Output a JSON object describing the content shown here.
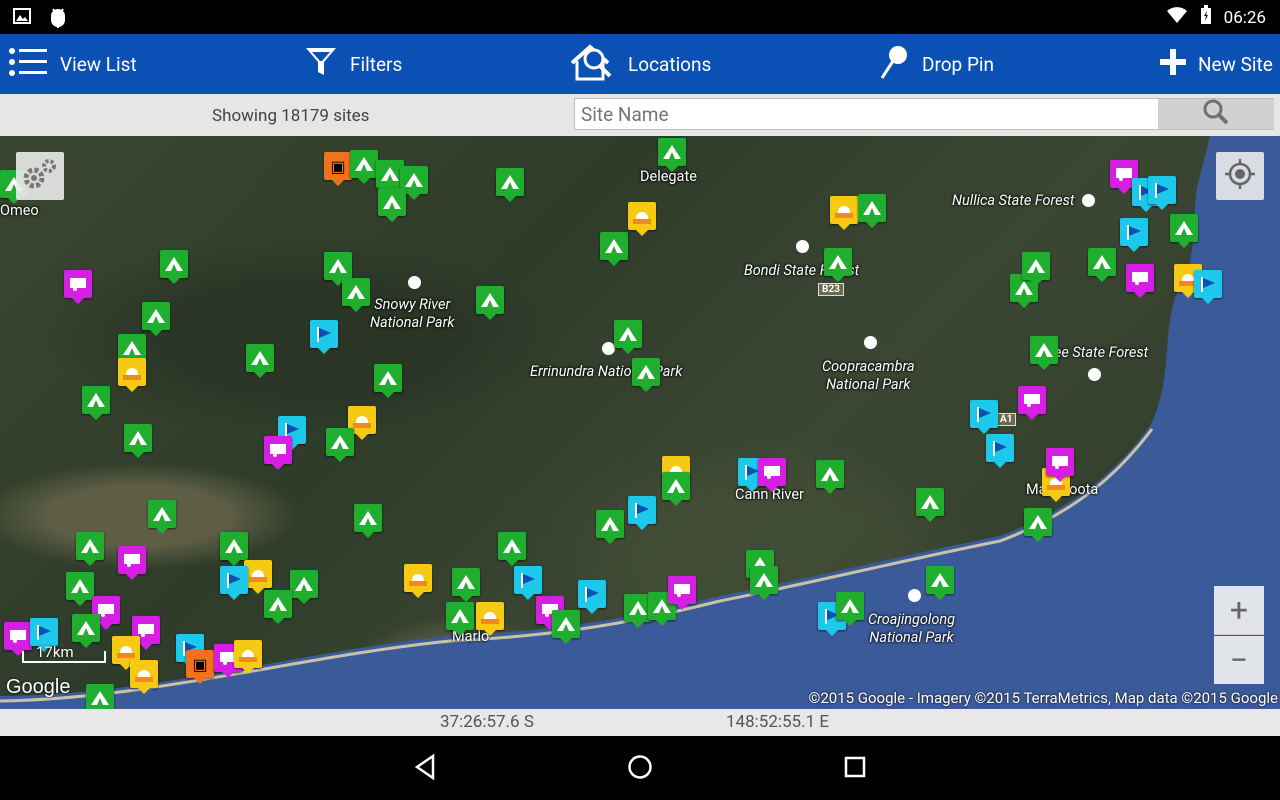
{
  "status_bar": {
    "time": "06:26",
    "icons": [
      "image-icon",
      "android-debug-icon",
      "wifi-icon",
      "battery-icon"
    ]
  },
  "toolbar": {
    "view_list": "View List",
    "filters": "Filters",
    "locations": "Locations",
    "drop_pin": "Drop Pin",
    "new_site": "New Site"
  },
  "search": {
    "showing": "Showing 18179 sites",
    "placeholder": "Site Name"
  },
  "map": {
    "places": {
      "omeo": "Omeo",
      "delegate": "Delegate",
      "nullica": "Nullica State Forest",
      "bondi": "Bondi State Forest",
      "snowy": "Snowy River\nNational Park",
      "errinundra": "Errinundra National Park",
      "coopracambra": "Coopracambra\nNational Park",
      "eden": "gee State Forest",
      "cann": "Cann River",
      "mallacoota": "Mallacoota",
      "marlo": "Marlo",
      "croajingolong": "Croajingolong\nNational Park"
    },
    "roads": {
      "b23": "B23",
      "a1": "A1"
    },
    "scale_label": "17km",
    "google_logo": "Google",
    "attribution": "©2015 Google - Imagery ©2015 TerraMetrics, Map data ©2015 Google"
  },
  "coords": {
    "lat": "37:26:57.6 S",
    "lon": "148:52:55.1 E"
  },
  "colors": {
    "toolbar": "#0b50b4",
    "tent": "#1fae2e",
    "flag": "#1ec8ea",
    "caravan": "#d61ee4",
    "sun": "#f6c913",
    "cabin": "#f0721c"
  }
}
